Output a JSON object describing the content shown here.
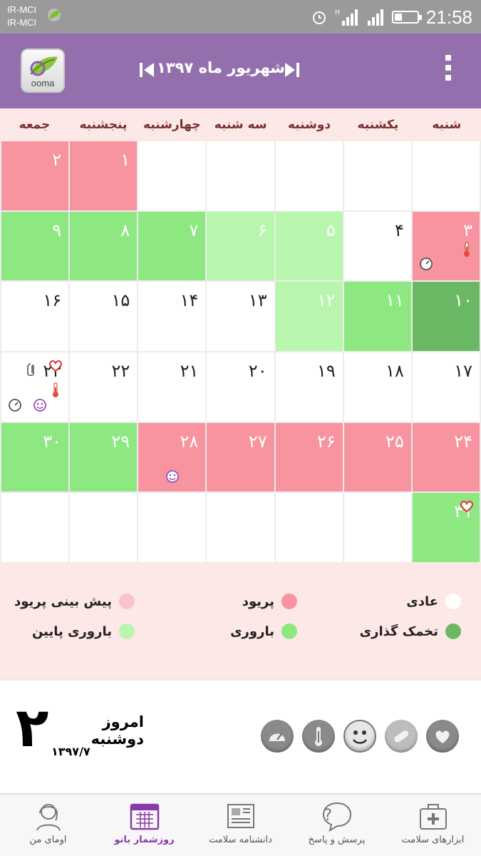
{
  "status_bar": {
    "carriers": [
      "IR-MCI",
      "IR-MCI"
    ],
    "time": "21:58",
    "icons": [
      "leaf-icon",
      "alarm-icon",
      "signal-icon",
      "wifi-icon",
      "battery-icon"
    ]
  },
  "header": {
    "logo_text": "ooma",
    "title": "شهریور ماه ۱۳۹۷",
    "prev_icon": "skip-previous-icon",
    "next_icon": "skip-next-icon",
    "menu_icon": "more-vertical-icon"
  },
  "calendar": {
    "weekdays": [
      "شنبه",
      "یکشنبه",
      "دوشنبه",
      "سه شنبه",
      "چهارشنبه",
      "پنجشنبه",
      "جمعه"
    ],
    "weeks": [
      [
        {
          "day": ""
        },
        {
          "day": ""
        },
        {
          "day": ""
        },
        {
          "day": ""
        },
        {
          "day": ""
        },
        {
          "day": "۱",
          "status": "period"
        },
        {
          "day": "۲",
          "status": "period"
        }
      ],
      [
        {
          "day": "۳",
          "status": "period",
          "icons": [
            "thermometer-icon",
            "scale-icon"
          ]
        },
        {
          "day": "۴",
          "status": "normal"
        },
        {
          "day": "۵",
          "status": "low"
        },
        {
          "day": "۶",
          "status": "low"
        },
        {
          "day": "۷",
          "status": "fertile"
        },
        {
          "day": "۸",
          "status": "fertile"
        },
        {
          "day": "۹",
          "status": "fertile"
        }
      ],
      [
        {
          "day": "۱۰",
          "status": "ovulation"
        },
        {
          "day": "۱۱",
          "status": "fertile"
        },
        {
          "day": "۱۲",
          "status": "low"
        },
        {
          "day": "۱۳",
          "status": "normal"
        },
        {
          "day": "۱۴",
          "status": "normal"
        },
        {
          "day": "۱۵",
          "status": "normal"
        },
        {
          "day": "۱۶",
          "status": "normal"
        }
      ],
      [
        {
          "day": "۱۷",
          "status": "normal"
        },
        {
          "day": "۱۸",
          "status": "normal"
        },
        {
          "day": "۱۹",
          "status": "normal"
        },
        {
          "day": "۲۰",
          "status": "normal"
        },
        {
          "day": "۲۱",
          "status": "normal"
        },
        {
          "day": "۲۲",
          "status": "normal"
        },
        {
          "day": "۲۳",
          "status": "normal",
          "icons": [
            "heart-icon",
            "pill-icon",
            "thermometer-icon",
            "scale-icon",
            "smiley-icon"
          ]
        }
      ],
      [
        {
          "day": "۲۴",
          "status": "predicted"
        },
        {
          "day": "۲۵",
          "status": "predicted"
        },
        {
          "day": "۲۶",
          "status": "predicted"
        },
        {
          "day": "۲۷",
          "status": "predicted"
        },
        {
          "day": "۲۸",
          "status": "predicted",
          "icons": [
            "smiley-icon"
          ]
        },
        {
          "day": "۲۹",
          "status": "fertile"
        },
        {
          "day": "۳۰",
          "status": "fertile"
        }
      ],
      [
        {
          "day": "۳۱",
          "status": "fertile",
          "icons": [
            "heart-icon"
          ]
        },
        {
          "day": ""
        },
        {
          "day": ""
        },
        {
          "day": ""
        },
        {
          "day": ""
        },
        {
          "day": ""
        },
        {
          "day": ""
        }
      ]
    ]
  },
  "legend": {
    "normal": "عادی",
    "period": "پریود",
    "predicted": "پیش بینی پریود",
    "ovulation": "تخمک گذاری",
    "fertile": "باروری",
    "low": "باروری پایین"
  },
  "today": {
    "big_number": "۲",
    "label": "امروز دوشنبه",
    "date": "۱۳۹۷/۷",
    "tools": [
      "heart-icon",
      "pill-icon",
      "smiley-icon",
      "thermometer-icon",
      "scale-icon"
    ]
  },
  "bottom_nav": [
    {
      "label": "ابزارهای سلامت",
      "icon": "first-aid-kit-icon"
    },
    {
      "label": "پرسش و پاسخ",
      "icon": "question-bubble-icon"
    },
    {
      "label": "دانشنامه سلامت",
      "icon": "newspaper-icon"
    },
    {
      "label": "روزشمار بانو",
      "icon": "calendar-icon",
      "active": true
    },
    {
      "label": "اومای من",
      "icon": "woman-profile-icon"
    }
  ],
  "colors": {
    "header": "#9370ad",
    "period": "#f7949f",
    "fertile": "#8ee882",
    "low_fertility": "#b9f6ad",
    "ovulation": "#6ab864",
    "background_pink": "#fde8e8",
    "active_nav": "#8a3aa8"
  }
}
